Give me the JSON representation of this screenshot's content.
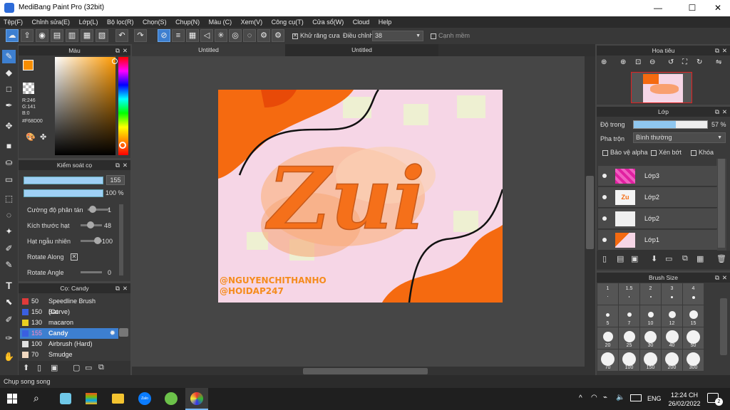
{
  "app": {
    "title": "MediBang Paint Pro (32bit)"
  },
  "window_controls": [
    "—",
    "☐",
    "✕"
  ],
  "menu": [
    "Tệp(F)",
    "Chỉnh sửa(E)",
    "Lớp(L)",
    "Bộ lọc(R)",
    "Chọn(S)",
    "Chụp(N)",
    "Màu (C)",
    "Xem(V)",
    "Công cụ(T)",
    "Cửa sổ(W)",
    "Cloud",
    "Help"
  ],
  "toolbar": {
    "antialias_label": "Khử răng cưa",
    "adjust_label": "Điều chỉnh",
    "adjust_value": "38",
    "sharp_edge_label": "Cạnh mềm"
  },
  "color_panel": {
    "title": "Màu",
    "r": "R:246",
    "g": "G:141",
    "b": "B:0",
    "hex": "#F68D00",
    "fg_color": "#F68D00"
  },
  "brush_control": {
    "title": "Kiểm soát cọ",
    "size_value": "155",
    "opacity_value": "100 %",
    "params": [
      {
        "label": "Cường độ phân tán",
        "value": "1"
      },
      {
        "label": "Kích thước hạt",
        "value": "48"
      },
      {
        "label": "Hạt ngẫu nhiên",
        "value": "100"
      },
      {
        "label": "Rotate Along",
        "value": "✕"
      },
      {
        "label": "Rotate Angle",
        "value": "0"
      }
    ]
  },
  "brush_list": {
    "title": "Cọ: Candy",
    "items": [
      {
        "size": "50",
        "name": "Speedline Brush (Curve)",
        "color": "#e03a3a"
      },
      {
        "size": "150",
        "name": "Bat",
        "color": "#3a5fe0"
      },
      {
        "size": "130",
        "name": "macaron",
        "color": "#e8d020"
      },
      {
        "size": "155",
        "name": "Candy",
        "color": "#3a5fe0"
      },
      {
        "size": "100",
        "name": "Airbrush (Hard)",
        "color": "#e0e0e0"
      },
      {
        "size": "70",
        "name": "Smudge",
        "color": "#f0d8c0"
      }
    ]
  },
  "tabs": [
    "Untitled",
    "Untitled"
  ],
  "artwork": {
    "text_main": "Zui",
    "watermark_1": "@NGUYENCHITHANHO",
    "watermark_2": "@HOIDAP247"
  },
  "navigator": {
    "title": "Hoa tiêu"
  },
  "layers": {
    "title": "Lớp",
    "opacity_label": "Độ trong",
    "opacity_value": "57 %",
    "opacity_fraction": 0.57,
    "blend_label": "Pha trộn",
    "blend_value": "Bình thường",
    "protect_alpha": "Bảo vệ alpha",
    "clipping": "Xén bớt",
    "lock": "Khóa",
    "items": [
      {
        "name": "Lớp3"
      },
      {
        "name": "Lớp2"
      },
      {
        "name": "Lớp2"
      },
      {
        "name": "Lớp1"
      }
    ]
  },
  "brush_size": {
    "title": "Brush Size",
    "sizes": [
      "1",
      "1.5",
      "2",
      "3",
      "4",
      "5",
      "7",
      "10",
      "12",
      "15",
      "20",
      "25",
      "30",
      "40",
      "50",
      "70",
      "100",
      "150",
      "200",
      "300"
    ]
  },
  "status": {
    "text": "Chụp song song"
  },
  "taskbar": {
    "time": "12:24 CH",
    "date": "26/02/2022",
    "lang": "ENG",
    "notif_count": "2"
  }
}
